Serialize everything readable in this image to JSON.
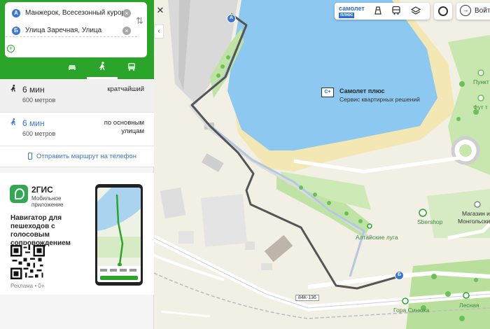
{
  "route": {
    "from": {
      "marker": "А",
      "text": "Манжерок, Всесезонный курорт"
    },
    "to": {
      "marker": "Б",
      "text": "Улица Заречная, Улица"
    },
    "add_point": "Добавить точку",
    "clear_glyph": "×",
    "swap_glyph": "⇅"
  },
  "modes": [
    {
      "name": "car",
      "glyph": "🚗"
    },
    {
      "name": "walk",
      "glyph": "🚶"
    },
    {
      "name": "bus",
      "glyph": "🚌"
    }
  ],
  "options": [
    {
      "time": "6 мин",
      "distance": "600 метров",
      "tag": "кратчайший"
    },
    {
      "time": "6 мин",
      "distance": "600 метров",
      "tag": "по основным улицам"
    }
  ],
  "send_to_phone": "Отправить маршрут на телефон",
  "ad": {
    "brand": "2ГИС",
    "subtitle": "Мобильное приложение",
    "description": "Навигатор для пешеходов с голосовым сопровождением",
    "label": "Реклама • 0+"
  },
  "topbar": {
    "samolet_line1": "самолет",
    "samolet_line2": "плюс",
    "login": "Войти"
  },
  "map": {
    "poi_samolet_title": "Самолет плюс",
    "poi_samolet_sub": "Сервис квартирных решений",
    "poi_punkt": "Пункт про",
    "poi_fut": "Фут т",
    "poi_sbershop": "Sbershop",
    "poi_magazin1": "Магазин из",
    "poi_magazin2": "Монгольский",
    "poi_luga": "Алтайские луга",
    "poi_gora": "Гора Синюха",
    "poi_lesnaya": "Лесная",
    "road_number": "84К-136",
    "marker_a": "А",
    "marker_b": "Б"
  }
}
